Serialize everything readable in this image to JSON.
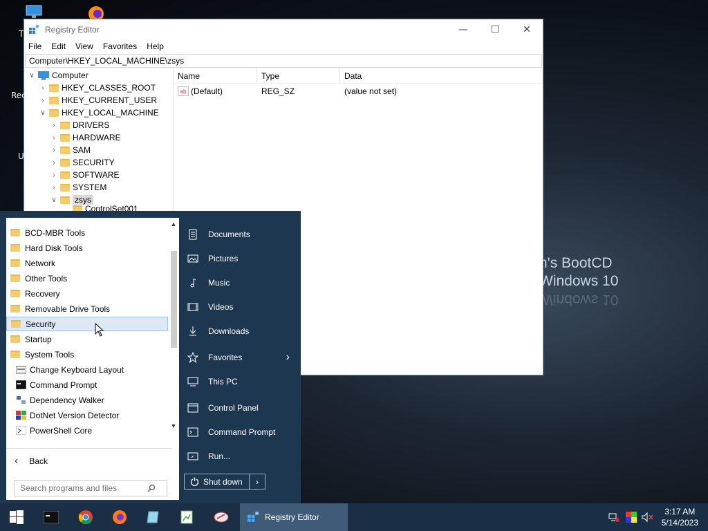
{
  "desktop": {
    "fragments": [
      "T",
      "Rec",
      "U"
    ],
    "brand": [
      "n's BootCD",
      "Windows 10",
      "Windows 10"
    ]
  },
  "registry": {
    "title": "Registry Editor",
    "menu": [
      "File",
      "Edit",
      "View",
      "Favorites",
      "Help"
    ],
    "address": "Computer\\HKEY_LOCAL_MACHINE\\zsys",
    "tree": [
      {
        "label": "Computer",
        "level": 0,
        "state": "expanded"
      },
      {
        "label": "HKEY_CLASSES_ROOT",
        "level": 1,
        "state": "collapsed"
      },
      {
        "label": "HKEY_CURRENT_USER",
        "level": 1,
        "state": "collapsed"
      },
      {
        "label": "HKEY_LOCAL_MACHINE",
        "level": 1,
        "state": "expanded"
      },
      {
        "label": "DRIVERS",
        "level": 2,
        "state": "collapsed"
      },
      {
        "label": "HARDWARE",
        "level": 2,
        "state": "collapsed"
      },
      {
        "label": "SAM",
        "level": 2,
        "state": "collapsed"
      },
      {
        "label": "SECURITY",
        "level": 2,
        "state": "collapsed"
      },
      {
        "label": "SOFTWARE",
        "level": 2,
        "state": "collapsed"
      },
      {
        "label": "SYSTEM",
        "level": 2,
        "state": "collapsed"
      },
      {
        "label": "zsys",
        "level": 2,
        "state": "expanded",
        "selected": true
      },
      {
        "label": "ControlSet001",
        "level": 3,
        "state": "leaf"
      }
    ],
    "columns": [
      "Name",
      "Type",
      "Data"
    ],
    "rows": [
      {
        "name": "(Default)",
        "type": "REG_SZ",
        "data": "(value not set)"
      }
    ]
  },
  "start_menu": {
    "programs": [
      {
        "label": "BCD-MBR Tools",
        "kind": "folder"
      },
      {
        "label": "Hard Disk Tools",
        "kind": "folder"
      },
      {
        "label": "Network",
        "kind": "folder"
      },
      {
        "label": "Other Tools",
        "kind": "folder"
      },
      {
        "label": "Recovery",
        "kind": "folder"
      },
      {
        "label": "Removable Drive Tools",
        "kind": "folder"
      },
      {
        "label": "Security",
        "kind": "folder",
        "highlighted": true
      },
      {
        "label": "Startup",
        "kind": "folder"
      },
      {
        "label": "System Tools",
        "kind": "folder"
      },
      {
        "label": "Change Keyboard Layout",
        "kind": "app"
      },
      {
        "label": "Command Prompt",
        "kind": "app"
      },
      {
        "label": "Dependency Walker",
        "kind": "app"
      },
      {
        "label": "DotNet Version Detector",
        "kind": "app"
      },
      {
        "label": "PowerShell Core",
        "kind": "app"
      }
    ],
    "back_label": "Back",
    "search_placeholder": "Search programs and files",
    "places": [
      {
        "label": "Documents",
        "icon": "document-icon"
      },
      {
        "label": "Pictures",
        "icon": "picture-icon"
      },
      {
        "label": "Music",
        "icon": "music-icon"
      },
      {
        "label": "Videos",
        "icon": "video-icon"
      },
      {
        "label": "Downloads",
        "icon": "download-icon"
      },
      {
        "label": "Favorites",
        "icon": "star-icon",
        "submenu": true
      },
      {
        "label": "This PC",
        "icon": "computer-icon"
      },
      {
        "label": "Control Panel",
        "icon": "control-panel-icon"
      },
      {
        "label": "Command Prompt",
        "icon": "terminal-icon"
      },
      {
        "label": "Run...",
        "icon": "run-icon"
      }
    ],
    "shutdown_label": "Shut down"
  },
  "taskbar": {
    "active_window": "Registry Editor",
    "clock_time": "3:17 AM",
    "clock_date": "5/14/2023"
  },
  "colors": {
    "startmenu_bg": "#1d3751",
    "taskbar_bg": "#1a2f45",
    "active_task": "#3f5b77",
    "highlight": "#dde9f6"
  }
}
